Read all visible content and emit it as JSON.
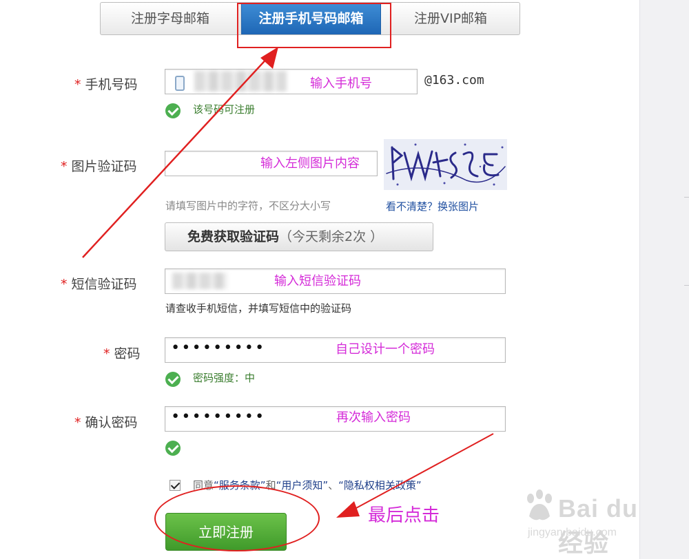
{
  "tabs": [
    {
      "label": "注册字母邮箱"
    },
    {
      "label": "注册手机号码邮箱"
    },
    {
      "label": "注册VIP邮箱"
    }
  ],
  "form": {
    "phone": {
      "label": "手机号码",
      "hint": "输入手机号",
      "domain": "@163.com",
      "status": "该号码可注册"
    },
    "captcha": {
      "label": "图片验证码",
      "hint": "输入左侧图片内容",
      "help": "请填写图片中的字符，不区分大小写",
      "refresh_link": "看不清楚？换张图片"
    },
    "sms_button": {
      "label": "免费获取验证码",
      "remaining": "（今天剩余2次 ）"
    },
    "sms": {
      "label": "短信验证码",
      "hint": "输入短信验证码",
      "help": "请查收手机短信，并填写短信中的验证码"
    },
    "password": {
      "label": "密码",
      "value": "•••••••••",
      "hint": "自己设计一个密码",
      "strength": "密码强度：中"
    },
    "confirm": {
      "label": "确认密码",
      "value": "•••••••••",
      "hint": "再次输入密码"
    },
    "agreement": {
      "prefix": "同意",
      "terms": "“服务条款”",
      "and": "和",
      "notice": "“用户须知”",
      "sep": "、",
      "privacy": "“隐私权相关政策”"
    },
    "submit": "立即注册"
  },
  "annotation": {
    "final_click": "最后点击",
    "color": "#d42ad8",
    "arrow_color": "#e02020"
  },
  "watermark": {
    "title": "Bai du 经验",
    "url": "jingyan.baidu.com"
  }
}
